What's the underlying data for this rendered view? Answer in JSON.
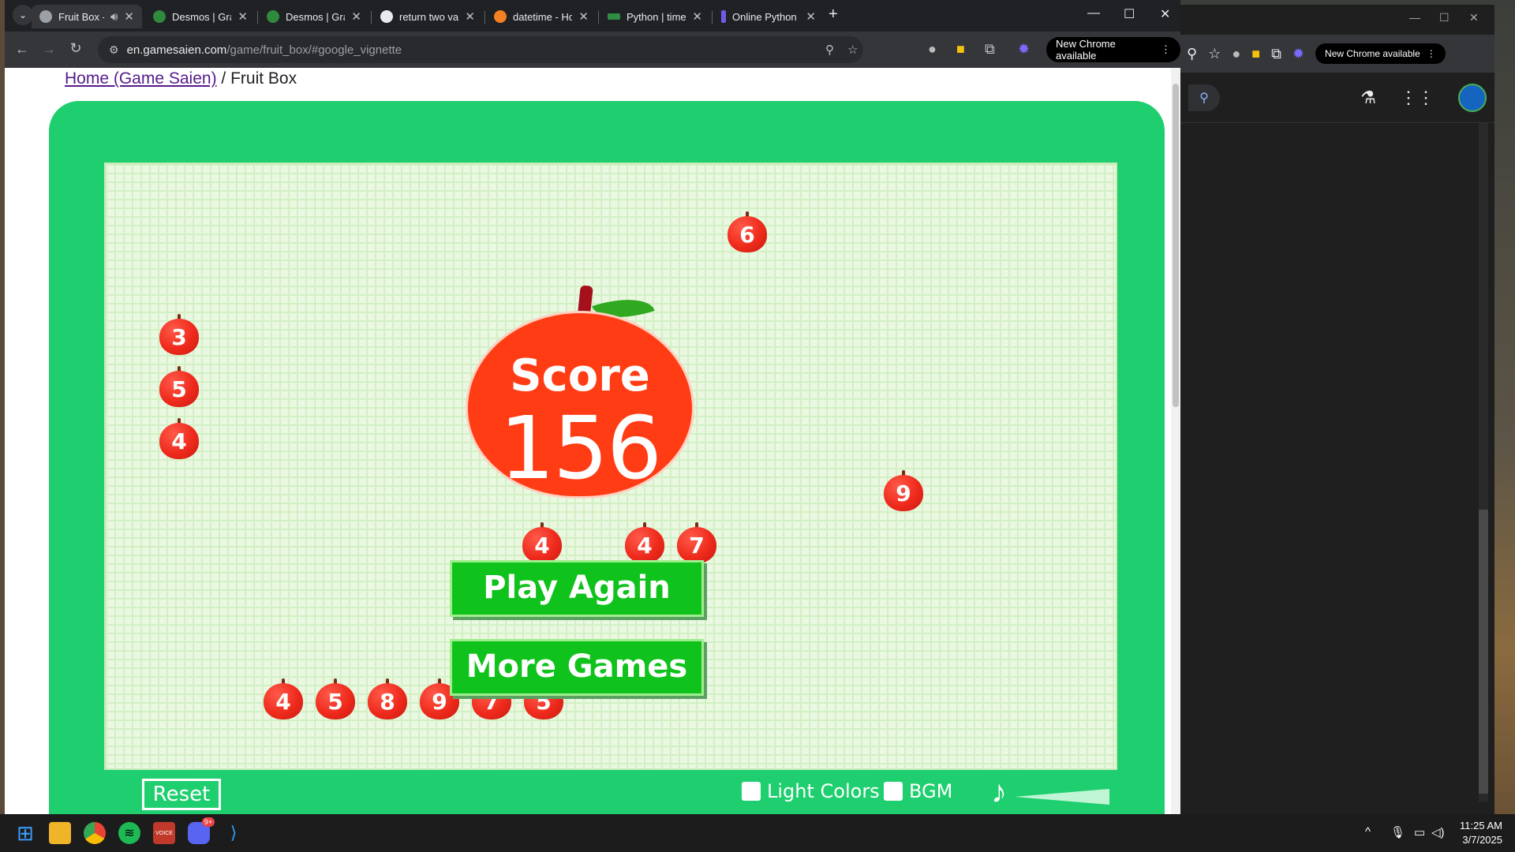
{
  "browser": {
    "tabs": [
      {
        "label": "Fruit Box - Free",
        "active": true,
        "audio": true,
        "icon": "globe-icon",
        "color": "#9aa0a6"
      },
      {
        "label": "Desmos | Graphing",
        "active": false,
        "icon": "desmos-icon",
        "color": "#2f8a3c"
      },
      {
        "label": "Desmos | Graphing",
        "active": false,
        "icon": "desmos-icon",
        "color": "#2f8a3c"
      },
      {
        "label": "return two variables",
        "active": false,
        "icon": "google-icon",
        "color": "#e8eaed"
      },
      {
        "label": "datetime - How do",
        "active": false,
        "icon": "stackoverflow-icon",
        "color": "#f48024"
      },
      {
        "label": "Python | time.time()",
        "active": false,
        "icon": "gfg-icon",
        "color": "#2f8d46"
      },
      {
        "label": "Online Python Com",
        "active": false,
        "icon": "programiz-icon",
        "color": "#6c5ce7"
      }
    ],
    "url_domain": "en.gamesaien.com",
    "url_path": "/game/fruit_box/#google_vignette",
    "new_chrome_label": "New Chrome available"
  },
  "page": {
    "breadcrumb_home": "Home (Game Saien)",
    "breadcrumb_sep": " / ",
    "breadcrumb_current": "Fruit Box"
  },
  "game": {
    "score_label": "Score",
    "score_value": "156",
    "play_again_label": "Play Again",
    "more_games_label": "More Games",
    "reset_label": "Reset",
    "light_colors_label": "Light Colors",
    "bgm_label": "BGM",
    "apples": [
      "6",
      "3",
      "5",
      "4",
      "9",
      "4",
      "4",
      "7",
      "4",
      "5",
      "8",
      "9",
      "7",
      "5"
    ]
  },
  "second_window": {
    "new_chrome_label": "New Chrome available"
  },
  "taskbar": {
    "time": "11:25 AM",
    "date": "3/7/2025",
    "discord_badge": "9+"
  }
}
